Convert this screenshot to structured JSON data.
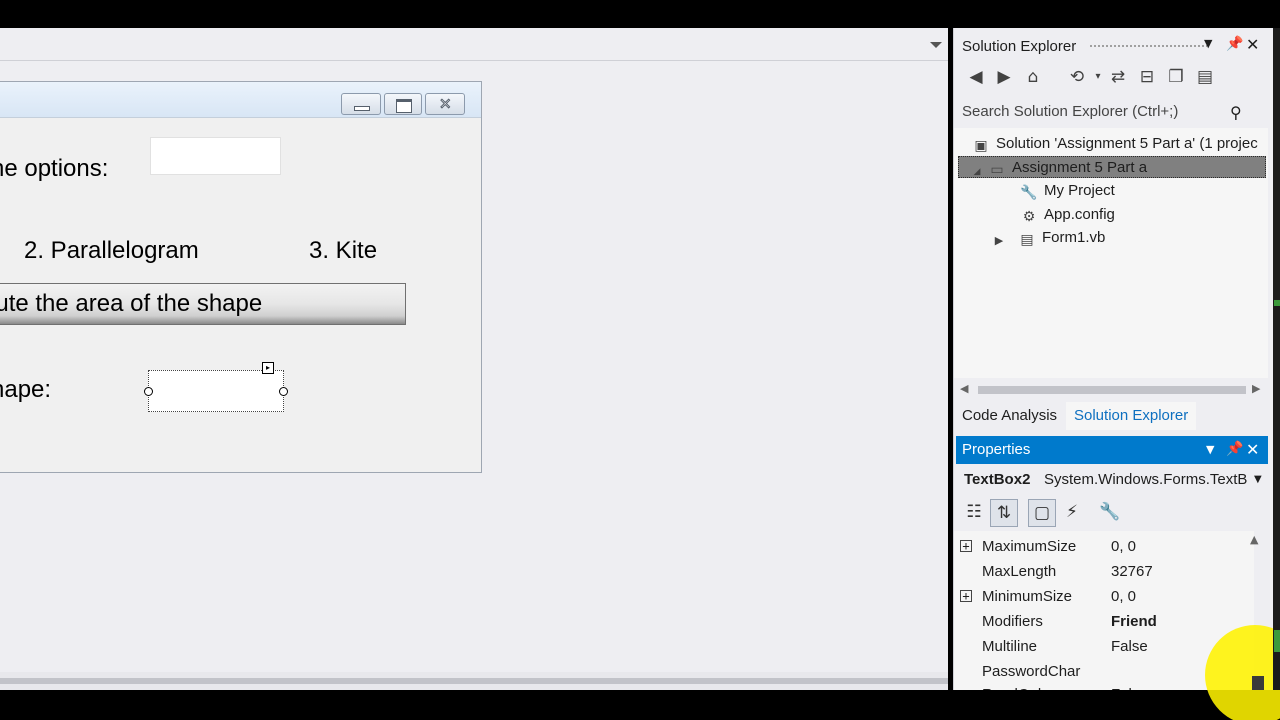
{
  "designer": {
    "form": {
      "label_options": "he options:",
      "label_parallelogram": "2. Parallelogram",
      "label_kite": "3. Kite",
      "compute_button": "pute the area of the shape",
      "label_shape": "hape:"
    }
  },
  "solution_explorer": {
    "title": "Solution Explorer",
    "search_placeholder": "Search Solution Explorer (Ctrl+;)",
    "tree": [
      {
        "label": "Solution 'Assignment 5 Part a' (1 projec"
      },
      {
        "label": "Assignment 5 Part a"
      },
      {
        "label": "My Project"
      },
      {
        "label": "App.config"
      },
      {
        "label": "Form1.vb"
      }
    ],
    "tabs": [
      "Code Analysis",
      "Solution Explorer"
    ]
  },
  "properties": {
    "title": "Properties",
    "object_name": "TextBox2",
    "object_type": "System.Windows.Forms.TextB",
    "rows": [
      {
        "name": "MaximumSize",
        "value": "0, 0"
      },
      {
        "name": "MaxLength",
        "value": "32767"
      },
      {
        "name": "MinimumSize",
        "value": "0, 0"
      },
      {
        "name": "Modifiers",
        "value": "Friend"
      },
      {
        "name": "Multiline",
        "value": "False"
      },
      {
        "name": "PasswordChar",
        "value": ""
      },
      {
        "name": "ReadOnly",
        "value": "False"
      }
    ]
  },
  "colors": {
    "accent": "#007acc",
    "selected_tab": "#0e70c0",
    "cursor_highlight": "#fff200"
  }
}
